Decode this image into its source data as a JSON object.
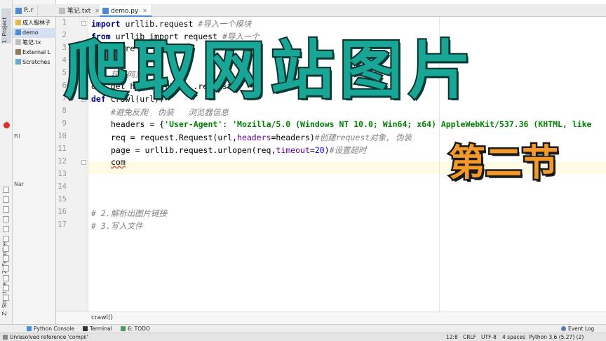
{
  "window": {
    "title": "demo.py"
  },
  "sidebar": {
    "project_tab": "1: Project",
    "favorites_tab": "2: Favorites",
    "structure_tab": "Z: Structure",
    "tree": [
      {
        "label": "P..r",
        "selected": false
      },
      {
        "label": "成人服林子",
        "selected": false
      },
      {
        "label": "demo",
        "selected": true
      },
      {
        "label": "笔记.tx",
        "selected": false
      },
      {
        "label": "External L",
        "selected": false
      },
      {
        "label": "Scratches",
        "selected": false
      }
    ],
    "fil_label": "Fil",
    "nar_label": "Nar"
  },
  "tabs": [
    {
      "label": "P..r",
      "active": false
    },
    {
      "label": "笔记.txt",
      "active": false
    },
    {
      "label": "demo.py",
      "active": true
    }
  ],
  "editor": {
    "line_numbers": [
      "1",
      "2",
      "3",
      "4",
      "5",
      "6",
      "7",
      "8",
      "9",
      "10",
      "11",
      "12",
      "13",
      "14",
      "15",
      "16",
      "17"
    ],
    "lines": {
      "l1_kw": "import",
      "l1_code": " urllib.request ",
      "l1_cm": "#导入一个模块",
      "l2_kw": "from",
      "l2_code": " urllib import request ",
      "l2_cm": "#导入一个",
      "l3_code": "import re",
      "l5_cm": "# 1.获取网页",
      "l6_code": "def get_html(url): ...request",
      "l7_kw": "def",
      "l7_code": " crawl(url):",
      "l8_cm": "#避免反爬  伪装   浏览器信息",
      "l9_code": "headers = {",
      "l9_str1": "'User-Agent'",
      "l9_sep": ": ",
      "l9_str2": "'Mozilla/5.0 (Windows NT 10.0; Win64; x64) AppleWebKit/537.36 (KHTML, like",
      "l10_code": "req = request.Request(url,",
      "l10_param": "headers",
      "l10_code2": "=headers)",
      "l10_cm": "#创建request对象, 伪装",
      "l11_code": "page = urllib.request.urlopen(req,",
      "l11_param": "timeout",
      "l11_eq": "=",
      "l11_num": "20",
      "l11_close": ")",
      "l11_cm": "#设置超时",
      "l12_code": "com",
      "l16_cm": "# 2.解析出图片链接",
      "l17_cm": "# 3.写入文件"
    }
  },
  "breadcrumb": {
    "text": "crawl()"
  },
  "bottom_tools": {
    "python_console": "Python Console",
    "terminal": "Terminal",
    "todo": "6: TODO",
    "event_log": "Event Log"
  },
  "status": {
    "message": "Unresolved reference 'compil'",
    "position": "12:8",
    "line_sep": "CRLF",
    "encoding": "UTF-8",
    "indent": "4 spaces",
    "interpreter": "Python 3.6 (5.27) (2)"
  },
  "overlay": {
    "title": "爬取网站图片",
    "section": "第二节"
  },
  "colors": {
    "title_fill": "#1aa697",
    "section_fill": "#f39a2b",
    "keyword": "#000080",
    "string": "#008000",
    "comment": "#808080"
  }
}
